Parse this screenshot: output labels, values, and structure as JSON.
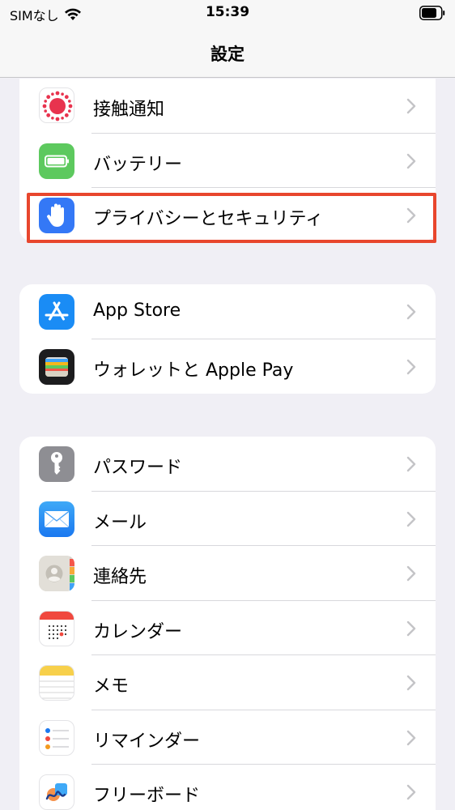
{
  "status": {
    "carrier": "SIMなし",
    "time": "15:39"
  },
  "nav": {
    "title": "設定"
  },
  "group1": [
    {
      "label": "接触通知",
      "icon": "exposure-notification-icon"
    },
    {
      "label": "バッテリー",
      "icon": "battery-icon"
    },
    {
      "label": "プライバシーとセキュリティ",
      "icon": "privacy-hand-icon"
    }
  ],
  "group2": [
    {
      "label": "App Store",
      "icon": "app-store-icon"
    },
    {
      "label": "ウォレットと Apple Pay",
      "icon": "wallet-icon"
    }
  ],
  "group3": [
    {
      "label": "パスワード",
      "icon": "key-icon"
    },
    {
      "label": "メール",
      "icon": "mail-icon"
    },
    {
      "label": "連絡先",
      "icon": "contacts-icon"
    },
    {
      "label": "カレンダー",
      "icon": "calendar-icon"
    },
    {
      "label": "メモ",
      "icon": "notes-icon"
    },
    {
      "label": "リマインダー",
      "icon": "reminders-icon"
    },
    {
      "label": "フリーボード",
      "icon": "freeform-icon"
    }
  ],
  "colors": {
    "highlight": "#e8462d",
    "background": "#f0eff5"
  }
}
